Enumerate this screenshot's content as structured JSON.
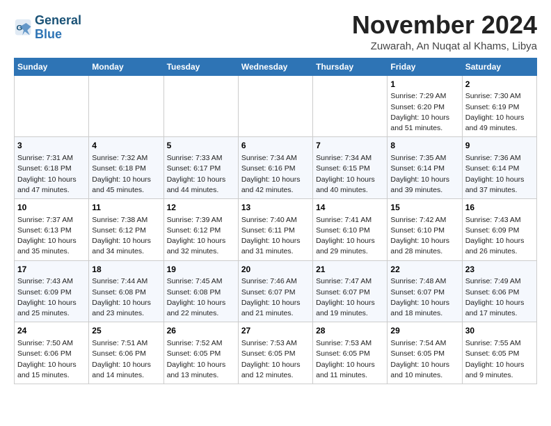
{
  "header": {
    "logo_line1": "General",
    "logo_line2": "Blue",
    "month": "November 2024",
    "location": "Zuwarah, An Nuqat al Khams, Libya"
  },
  "weekdays": [
    "Sunday",
    "Monday",
    "Tuesday",
    "Wednesday",
    "Thursday",
    "Friday",
    "Saturday"
  ],
  "weeks": [
    [
      {
        "day": "",
        "info": ""
      },
      {
        "day": "",
        "info": ""
      },
      {
        "day": "",
        "info": ""
      },
      {
        "day": "",
        "info": ""
      },
      {
        "day": "",
        "info": ""
      },
      {
        "day": "1",
        "info": "Sunrise: 7:29 AM\nSunset: 6:20 PM\nDaylight: 10 hours and 51 minutes."
      },
      {
        "day": "2",
        "info": "Sunrise: 7:30 AM\nSunset: 6:19 PM\nDaylight: 10 hours and 49 minutes."
      }
    ],
    [
      {
        "day": "3",
        "info": "Sunrise: 7:31 AM\nSunset: 6:18 PM\nDaylight: 10 hours and 47 minutes."
      },
      {
        "day": "4",
        "info": "Sunrise: 7:32 AM\nSunset: 6:18 PM\nDaylight: 10 hours and 45 minutes."
      },
      {
        "day": "5",
        "info": "Sunrise: 7:33 AM\nSunset: 6:17 PM\nDaylight: 10 hours and 44 minutes."
      },
      {
        "day": "6",
        "info": "Sunrise: 7:34 AM\nSunset: 6:16 PM\nDaylight: 10 hours and 42 minutes."
      },
      {
        "day": "7",
        "info": "Sunrise: 7:34 AM\nSunset: 6:15 PM\nDaylight: 10 hours and 40 minutes."
      },
      {
        "day": "8",
        "info": "Sunrise: 7:35 AM\nSunset: 6:14 PM\nDaylight: 10 hours and 39 minutes."
      },
      {
        "day": "9",
        "info": "Sunrise: 7:36 AM\nSunset: 6:14 PM\nDaylight: 10 hours and 37 minutes."
      }
    ],
    [
      {
        "day": "10",
        "info": "Sunrise: 7:37 AM\nSunset: 6:13 PM\nDaylight: 10 hours and 35 minutes."
      },
      {
        "day": "11",
        "info": "Sunrise: 7:38 AM\nSunset: 6:12 PM\nDaylight: 10 hours and 34 minutes."
      },
      {
        "day": "12",
        "info": "Sunrise: 7:39 AM\nSunset: 6:12 PM\nDaylight: 10 hours and 32 minutes."
      },
      {
        "day": "13",
        "info": "Sunrise: 7:40 AM\nSunset: 6:11 PM\nDaylight: 10 hours and 31 minutes."
      },
      {
        "day": "14",
        "info": "Sunrise: 7:41 AM\nSunset: 6:10 PM\nDaylight: 10 hours and 29 minutes."
      },
      {
        "day": "15",
        "info": "Sunrise: 7:42 AM\nSunset: 6:10 PM\nDaylight: 10 hours and 28 minutes."
      },
      {
        "day": "16",
        "info": "Sunrise: 7:43 AM\nSunset: 6:09 PM\nDaylight: 10 hours and 26 minutes."
      }
    ],
    [
      {
        "day": "17",
        "info": "Sunrise: 7:43 AM\nSunset: 6:09 PM\nDaylight: 10 hours and 25 minutes."
      },
      {
        "day": "18",
        "info": "Sunrise: 7:44 AM\nSunset: 6:08 PM\nDaylight: 10 hours and 23 minutes."
      },
      {
        "day": "19",
        "info": "Sunrise: 7:45 AM\nSunset: 6:08 PM\nDaylight: 10 hours and 22 minutes."
      },
      {
        "day": "20",
        "info": "Sunrise: 7:46 AM\nSunset: 6:07 PM\nDaylight: 10 hours and 21 minutes."
      },
      {
        "day": "21",
        "info": "Sunrise: 7:47 AM\nSunset: 6:07 PM\nDaylight: 10 hours and 19 minutes."
      },
      {
        "day": "22",
        "info": "Sunrise: 7:48 AM\nSunset: 6:07 PM\nDaylight: 10 hours and 18 minutes."
      },
      {
        "day": "23",
        "info": "Sunrise: 7:49 AM\nSunset: 6:06 PM\nDaylight: 10 hours and 17 minutes."
      }
    ],
    [
      {
        "day": "24",
        "info": "Sunrise: 7:50 AM\nSunset: 6:06 PM\nDaylight: 10 hours and 15 minutes."
      },
      {
        "day": "25",
        "info": "Sunrise: 7:51 AM\nSunset: 6:06 PM\nDaylight: 10 hours and 14 minutes."
      },
      {
        "day": "26",
        "info": "Sunrise: 7:52 AM\nSunset: 6:05 PM\nDaylight: 10 hours and 13 minutes."
      },
      {
        "day": "27",
        "info": "Sunrise: 7:53 AM\nSunset: 6:05 PM\nDaylight: 10 hours and 12 minutes."
      },
      {
        "day": "28",
        "info": "Sunrise: 7:53 AM\nSunset: 6:05 PM\nDaylight: 10 hours and 11 minutes."
      },
      {
        "day": "29",
        "info": "Sunrise: 7:54 AM\nSunset: 6:05 PM\nDaylight: 10 hours and 10 minutes."
      },
      {
        "day": "30",
        "info": "Sunrise: 7:55 AM\nSunset: 6:05 PM\nDaylight: 10 hours and 9 minutes."
      }
    ]
  ]
}
